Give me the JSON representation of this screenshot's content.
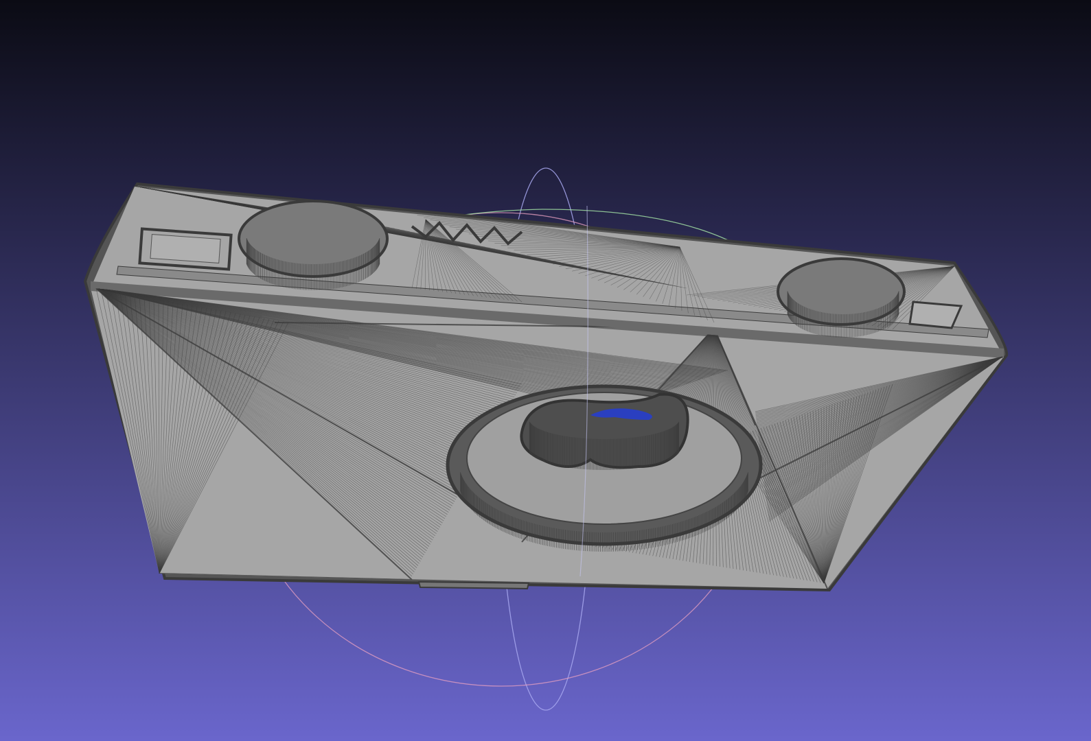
{
  "viewer": {
    "background": {
      "top": "#0b0b14",
      "bottom": "#6a66cc"
    },
    "mesh": {
      "fill": "#a6a6a6",
      "wire": "#3c3c3c",
      "edge": "#4a4a4a",
      "hole_color": "#2a3fc0"
    },
    "trackball": {
      "x_ring": "#e8a0c0",
      "y_ring": "#a8e8a8",
      "z_ring": "#a8a8f0"
    }
  }
}
